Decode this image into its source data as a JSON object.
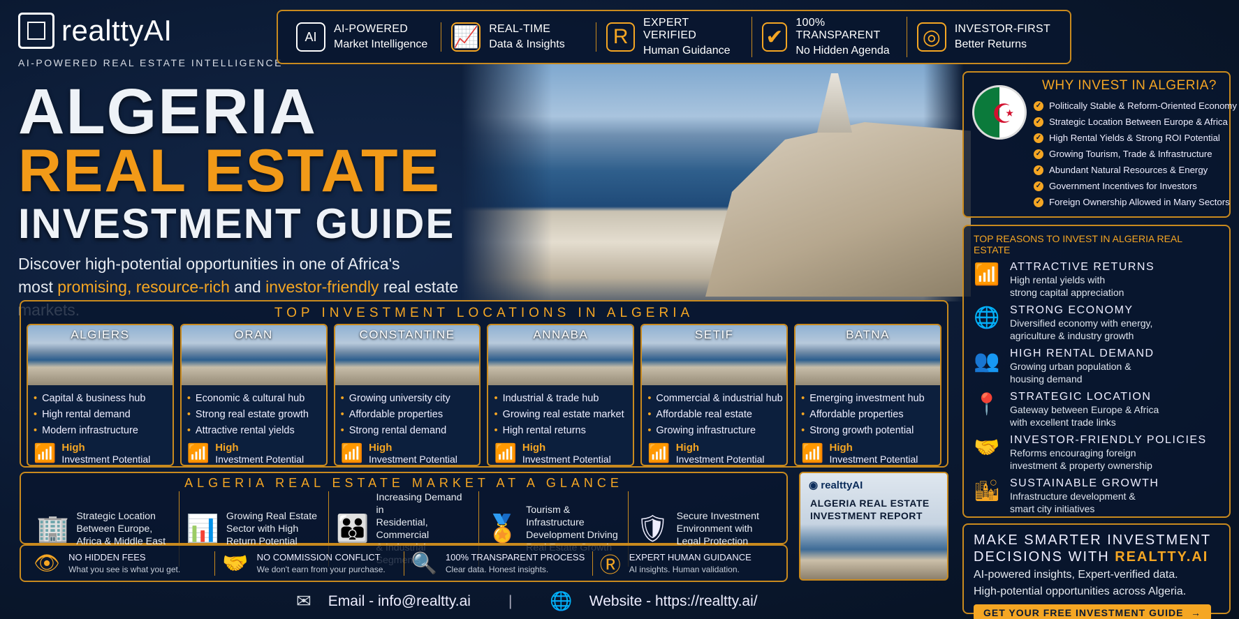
{
  "brand": {
    "name": "realttyAI",
    "tagline": "AI-POWERED REAL ESTATE INTELLIGENCE"
  },
  "features": [
    {
      "icon": "ai-chip-icon",
      "glyph": "AI",
      "t1": "AI-POWERED",
      "t2": "Market Intelligence"
    },
    {
      "icon": "growth-chart-icon",
      "glyph": "📈",
      "t1": "REAL-TIME",
      "t2": "Data & Insights"
    },
    {
      "icon": "expert-badge-icon",
      "glyph": "R",
      "t1": "EXPERT VERIFIED",
      "t2": "Human Guidance"
    },
    {
      "icon": "shield-check-icon",
      "glyph": "✔",
      "t1": "100% TRANSPARENT",
      "t2": "No Hidden Agenda"
    },
    {
      "icon": "target-icon",
      "glyph": "◎",
      "t1": "INVESTOR-FIRST",
      "t2": "Better Returns"
    }
  ],
  "hero": {
    "line1": "ALGERIA",
    "line2": "REAL ESTATE",
    "line3": "INVESTMENT GUIDE",
    "sub_a": "Discover high-potential opportunities in one of Africa's",
    "sub_b": "most ",
    "sub_c": "promising, resource-rich",
    "sub_d": " and ",
    "sub_e": "investor-friendly",
    "sub_f": " real estate markets."
  },
  "why": {
    "title": "WHY INVEST IN ALGERIA?",
    "items": [
      "Politically Stable & Reform-Oriented Economy",
      "Strategic Location Between Europe & Africa",
      "High Rental Yields & Strong ROI Potential",
      "Growing Tourism, Trade & Infrastructure",
      "Abundant Natural Resources & Energy",
      "Government Incentives for Investors",
      "Foreign Ownership Allowed in Many Sectors"
    ]
  },
  "reasons": {
    "title": "TOP REASONS TO INVEST IN ALGERIA REAL ESTATE",
    "items": [
      {
        "icon": "bar-growth-icon",
        "glyph": "📶",
        "h": "ATTRACTIVE RETURNS",
        "d1": "High rental yields with",
        "d2": "strong capital appreciation"
      },
      {
        "icon": "globe-icon",
        "glyph": "🌐",
        "h": "STRONG ECONOMY",
        "d1": "Diversified economy with energy,",
        "d2": "agriculture & industry growth"
      },
      {
        "icon": "people-icon",
        "glyph": "👥",
        "h": "HIGH RENTAL DEMAND",
        "d1": "Growing urban population &",
        "d2": "housing demand"
      },
      {
        "icon": "location-pin-icon",
        "glyph": "📍",
        "h": "STRATEGIC LOCATION",
        "d1": "Gateway between Europe & Africa",
        "d2": "with excellent trade links"
      },
      {
        "icon": "handshake-icon",
        "glyph": "🤝",
        "h": "INVESTOR-FRIENDLY POLICIES",
        "d1": "Reforms encouraging foreign",
        "d2": "investment & property ownership"
      },
      {
        "icon": "city-growth-icon",
        "glyph": "🏙",
        "h": "SUSTAINABLE GROWTH",
        "d1": "Infrastructure development &",
        "d2": "smart city initiatives"
      }
    ]
  },
  "locations": {
    "title": "TOP INVESTMENT LOCATIONS IN ALGERIA",
    "cards": [
      {
        "name": "ALGIERS",
        "b": [
          "Capital & business hub",
          "High rental demand",
          "Modern infrastructure"
        ],
        "pot": "High",
        "pot_label": "Investment Potential"
      },
      {
        "name": "ORAN",
        "b": [
          "Economic & cultural hub",
          "Strong real estate growth",
          "Attractive rental yields"
        ],
        "pot": "High",
        "pot_label": "Investment Potential"
      },
      {
        "name": "CONSTANTINE",
        "b": [
          "Growing university city",
          "Affordable properties",
          "Strong rental demand"
        ],
        "pot": "High",
        "pot_label": "Investment Potential"
      },
      {
        "name": "ANNABA",
        "b": [
          "Industrial & trade hub",
          "Growing real estate market",
          "High rental returns"
        ],
        "pot": "High",
        "pot_label": "Investment Potential"
      },
      {
        "name": "SETIF",
        "b": [
          "Commercial & industrial hub",
          "Affordable real estate",
          "Growing infrastructure"
        ],
        "pot": "High",
        "pot_label": "Investment Potential"
      },
      {
        "name": "BATNA",
        "b": [
          "Emerging investment hub",
          "Affordable properties",
          "Strong growth potential"
        ],
        "pot": "High",
        "pot_label": "Investment Potential"
      }
    ]
  },
  "glance": {
    "title": "ALGERIA REAL ESTATE MARKET AT A GLANCE",
    "items": [
      {
        "icon": "buildings-icon",
        "glyph": "🏢",
        "l1": "Strategic Location",
        "l2": "Between Europe,",
        "l3": "Africa & Middle East"
      },
      {
        "icon": "rising-chart-icon",
        "glyph": "📊",
        "l1": "Growing Real Estate",
        "l2": "Sector with High",
        "l3": "Return Potential"
      },
      {
        "icon": "group-icon",
        "glyph": "👪",
        "l1": "Increasing Demand in",
        "l2": "Residential, Commercial",
        "l3": "& Industrial Segments"
      },
      {
        "icon": "medal-icon",
        "glyph": "🏅",
        "l1": "Tourism & Infrastructure",
        "l2": "Development Driving",
        "l3": "Real Estate Growth"
      },
      {
        "icon": "shield-dollar-icon",
        "glyph": "🛡",
        "l1": "Secure Investment",
        "l2": "Environment with",
        "l3": "Legal Protection"
      }
    ]
  },
  "report": {
    "brand": "realttyAI",
    "title1": "ALGERIA REAL ESTATE",
    "title2": "INVESTMENT REPORT"
  },
  "trust": [
    {
      "icon": "eye-icon",
      "glyph": "👁",
      "h": "NO HIDDEN FEES",
      "d": "What you see is what you get."
    },
    {
      "icon": "handshake-icon",
      "glyph": "🤝",
      "h": "NO COMMISSION CONFLICT",
      "d": "We don't earn from your purchase."
    },
    {
      "icon": "magnifier-icon",
      "glyph": "🔍",
      "h": "100% TRANSPARENT PROCESS",
      "d": "Clear data. Honest insights."
    },
    {
      "icon": "expert-icon",
      "glyph": "Ⓡ",
      "h": "EXPERT HUMAN GUIDANCE",
      "d": "AI insights. Human validation."
    }
  ],
  "cta": {
    "h1": "MAKE SMARTER INVESTMENT",
    "h2a": "DECISIONS WITH ",
    "h2b": "REALTTY.AI",
    "d1": "AI-powered insights, Expert-verified data.",
    "d2": "High-potential opportunities across Algeria.",
    "button": "GET YOUR FREE INVESTMENT GUIDE",
    "arrow": "→"
  },
  "contact": {
    "email": "Email - info@realtty.ai",
    "sep": "|",
    "website": "Website - https://realtty.ai/"
  },
  "colors": {
    "accent": "#f5a623",
    "bg": "#0b1a33"
  }
}
